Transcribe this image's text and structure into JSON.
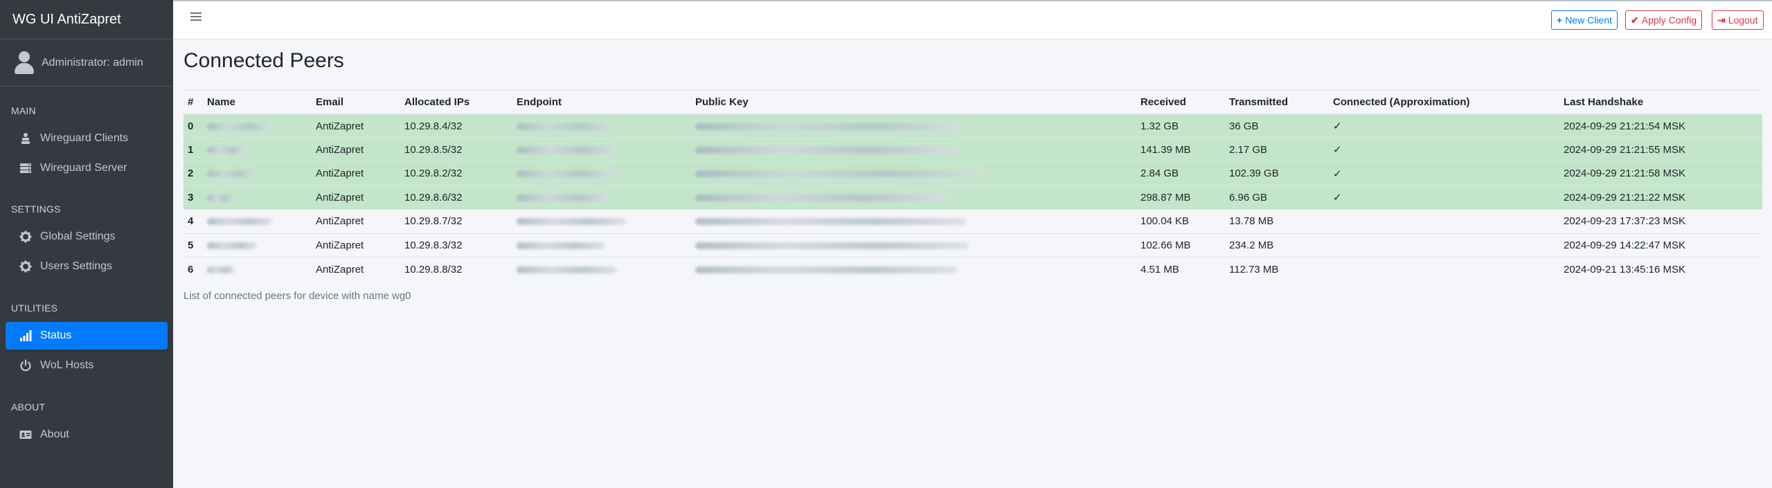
{
  "brand": "WG UI AntiZapret",
  "user": "Administrator: admin",
  "sidebar": {
    "main_header": "MAIN",
    "settings_header": "SETTINGS",
    "utilities_header": "UTILITIES",
    "about_header": "ABOUT",
    "items": [
      {
        "label": "Wireguard Clients",
        "icon": "users-icon"
      },
      {
        "label": "Wireguard Server",
        "icon": "server-icon"
      },
      {
        "label": "Global Settings",
        "icon": "gear-icon"
      },
      {
        "label": "Users Settings",
        "icon": "gear-icon"
      },
      {
        "label": "Status",
        "icon": "signal-icon",
        "active": true
      },
      {
        "label": "WoL Hosts",
        "icon": "power-icon"
      },
      {
        "label": "About",
        "icon": "id-card-icon"
      }
    ]
  },
  "toolbar": {
    "new_client": "New Client",
    "apply_config": "Apply Config",
    "logout": "Logout"
  },
  "page_title": "Connected Peers",
  "table": {
    "headers": [
      "#",
      "Name",
      "Email",
      "Allocated IPs",
      "Endpoint",
      "Public Key",
      "Received",
      "Transmitted",
      "Connected (Approximation)",
      "Last Handshake"
    ],
    "rows": [
      {
        "idx": "0",
        "email": "AntiZapret",
        "ip": "10.29.8.4/32",
        "received": "1.32 GB",
        "transmitted": "36 GB",
        "connected": "✓",
        "handshake": "2024-09-29 21:21:54 MSK"
      },
      {
        "idx": "1",
        "email": "AntiZapret",
        "ip": "10.29.8.5/32",
        "received": "141.39 MB",
        "transmitted": "2.17 GB",
        "connected": "✓",
        "handshake": "2024-09-29 21:21:55 MSK"
      },
      {
        "idx": "2",
        "email": "AntiZapret",
        "ip": "10.29.8.2/32",
        "received": "2.84 GB",
        "transmitted": "102.39 GB",
        "connected": "✓",
        "handshake": "2024-09-29 21:21:58 MSK"
      },
      {
        "idx": "3",
        "email": "AntiZapret",
        "ip": "10.29.8.6/32",
        "received": "298.87 MB",
        "transmitted": "6.96 GB",
        "connected": "✓",
        "handshake": "2024-09-29 21:21:22 MSK"
      },
      {
        "idx": "4",
        "email": "AntiZapret",
        "ip": "10.29.8.7/32",
        "received": "100.04 KB",
        "transmitted": "13.78 MB",
        "connected": "",
        "handshake": "2024-09-23 17:37:23 MSK"
      },
      {
        "idx": "5",
        "email": "AntiZapret",
        "ip": "10.29.8.3/32",
        "received": "102.66 MB",
        "transmitted": "234.2 MB",
        "connected": "",
        "handshake": "2024-09-29 14:22:47 MSK"
      },
      {
        "idx": "6",
        "email": "AntiZapret",
        "ip": "10.29.8.8/32",
        "received": "4.51 MB",
        "transmitted": "112.73 MB",
        "connected": "",
        "handshake": "2024-09-21 13:45:16 MSK"
      }
    ]
  },
  "caption": "List of connected peers for device with name wg0",
  "colors": {
    "sidebar_bg": "#343a40",
    "accent": "#007bff",
    "danger": "#dc3545",
    "connected_row": "#c3e6cb"
  }
}
